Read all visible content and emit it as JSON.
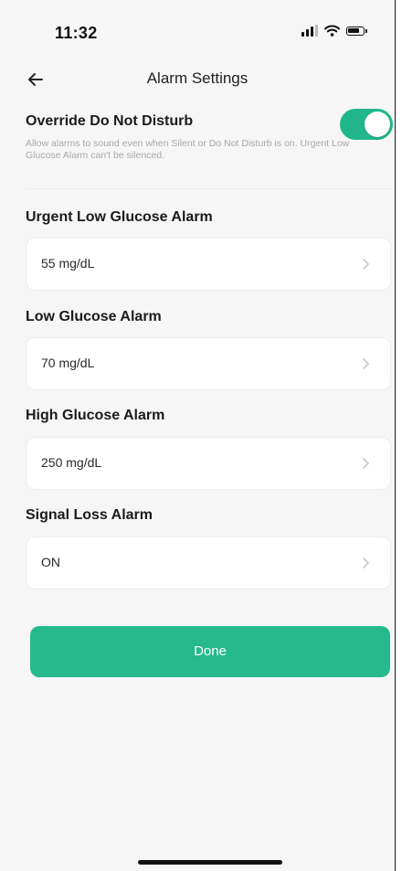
{
  "status_bar": {
    "time": "11:32",
    "icons": [
      "cellular-signal-icon",
      "wifi-icon",
      "battery-icon"
    ]
  },
  "nav": {
    "back_icon": "arrow-left-icon",
    "title": "Alarm Settings"
  },
  "override": {
    "title": "Override Do Not Disturb",
    "description": "Allow alarms to sound even when Silent or Do Not Disturb is on. Urgent Low Glucose Alarm can't be silenced.",
    "enabled": true,
    "toggle_color": "#22b78b"
  },
  "alarms": [
    {
      "title": "Urgent Low Glucose Alarm",
      "value": "55 mg/dL"
    },
    {
      "title": "Low Glucose Alarm",
      "value": "70 mg/dL"
    },
    {
      "title": "High Glucose Alarm",
      "value": "250 mg/dL"
    },
    {
      "title": "Signal Loss Alarm",
      "value": "ON"
    }
  ],
  "done_button": {
    "label": "Done",
    "color": "#25b98c"
  }
}
